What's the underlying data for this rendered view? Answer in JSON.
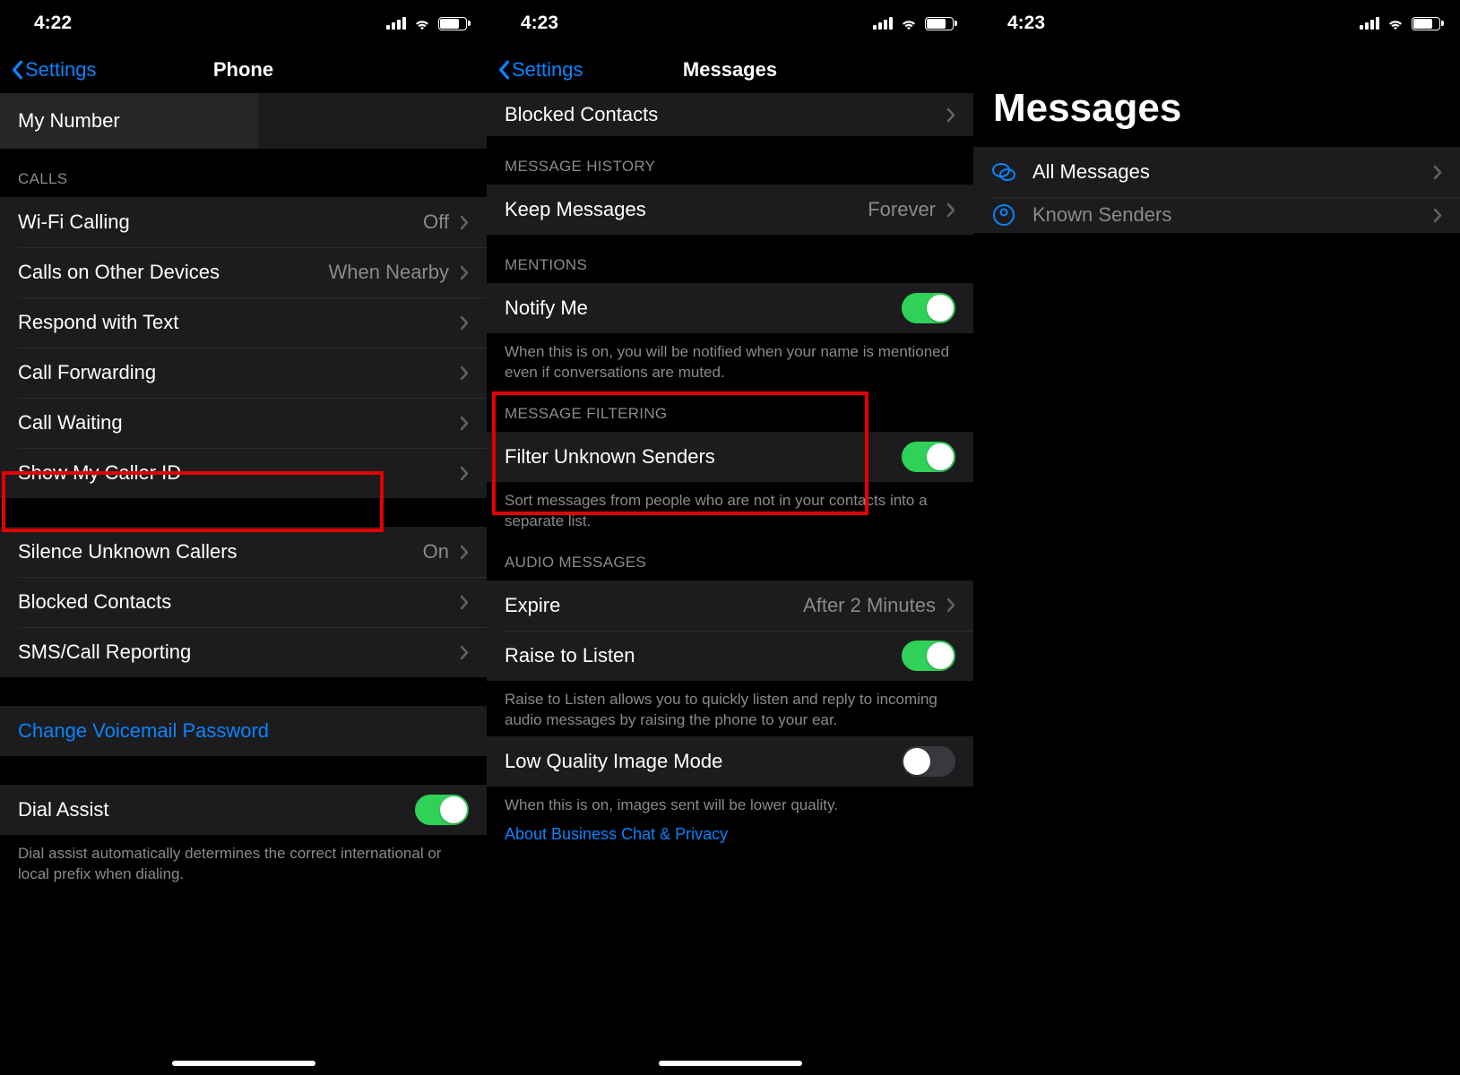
{
  "s1": {
    "time": "4:22",
    "back": "Settings",
    "title": "Phone",
    "my_number": "My Number",
    "sec_calls": "CALLS",
    "rows": {
      "wifi_calling": "Wi-Fi Calling",
      "wifi_calling_val": "Off",
      "other_devices": "Calls on Other Devices",
      "other_devices_val": "When Nearby",
      "respond_text": "Respond with Text",
      "call_forwarding": "Call Forwarding",
      "call_waiting": "Call Waiting",
      "caller_id": "Show My Caller ID",
      "silence_unknown": "Silence Unknown Callers",
      "silence_unknown_val": "On",
      "blocked": "Blocked Contacts",
      "sms_reporting": "SMS/Call Reporting",
      "change_vm": "Change Voicemail Password",
      "dial_assist": "Dial Assist"
    },
    "dial_assist_desc": "Dial assist automatically determines the correct international or local prefix when dialing."
  },
  "s2": {
    "time": "4:23",
    "back": "Settings",
    "title": "Messages",
    "rows": {
      "blocked": "Blocked Contacts",
      "sec_history": "MESSAGE HISTORY",
      "keep_msgs": "Keep Messages",
      "keep_msgs_val": "Forever",
      "sec_mentions": "MENTIONS",
      "notify_me": "Notify Me",
      "notify_desc": "When this is on, you will be notified when your name is mentioned even if conversations are muted.",
      "sec_filter": "MESSAGE FILTERING",
      "filter_unknown": "Filter Unknown Senders",
      "filter_desc": "Sort messages from people who are not in your contacts into a separate list.",
      "sec_audio": "AUDIO MESSAGES",
      "expire": "Expire",
      "expire_val": "After 2 Minutes",
      "raise_listen": "Raise to Listen",
      "raise_desc": "Raise to Listen allows you to quickly listen and reply to incoming audio messages by raising the phone to your ear.",
      "low_quality": "Low Quality Image Mode",
      "low_quality_desc": "When this is on, images sent will be lower quality.",
      "about_link": "About Business Chat & Privacy"
    }
  },
  "s3": {
    "time": "4:23",
    "title": "Messages",
    "all_msgs": "All Messages",
    "known_senders": "Known Senders"
  }
}
